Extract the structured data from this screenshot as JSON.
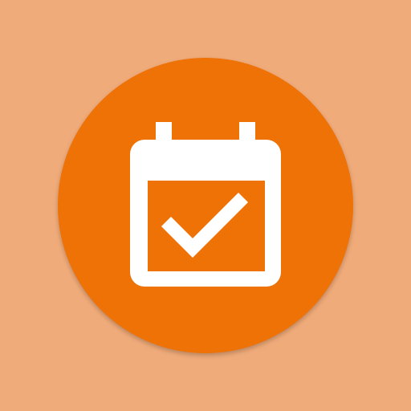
{
  "app_icon": {
    "icon": "calendar-check-icon",
    "colors": {
      "background": "#F0AB7A",
      "circle": "#EF7206",
      "glyph": "#FFFFFF"
    }
  }
}
